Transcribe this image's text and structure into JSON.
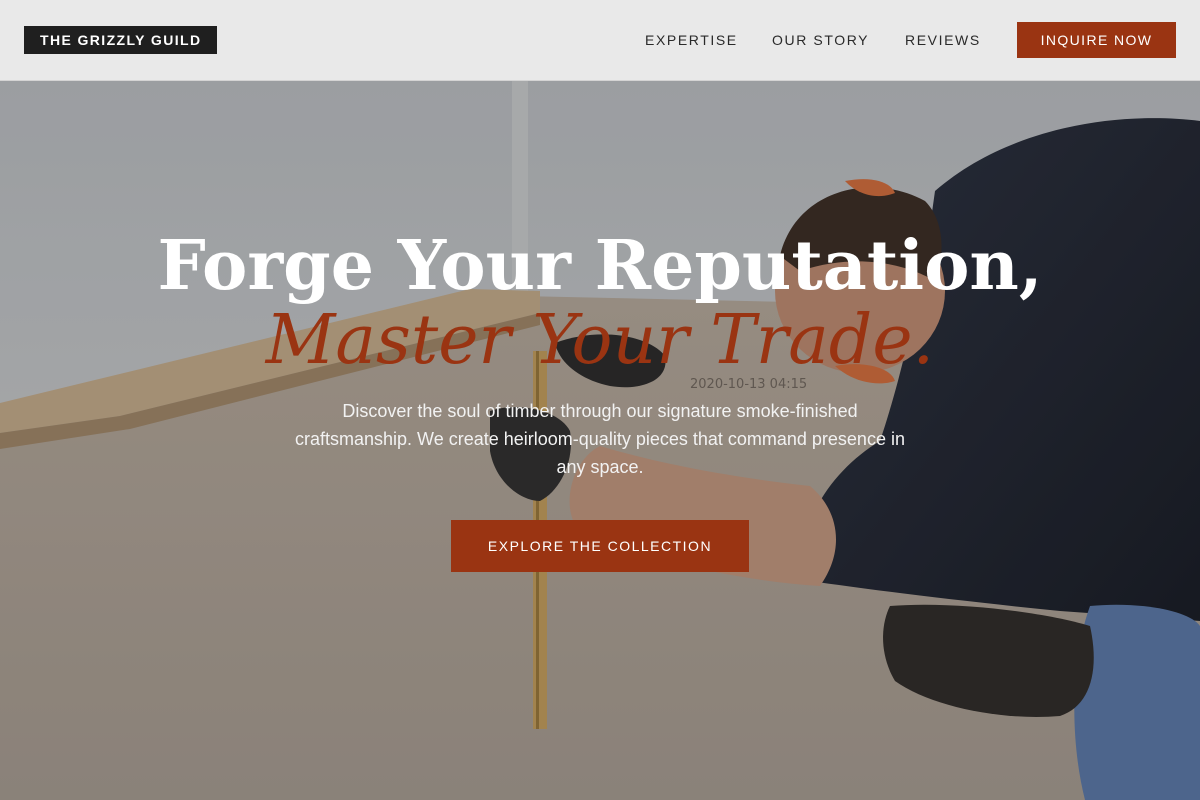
{
  "header": {
    "logo": "THE GRIZZLY GUILD",
    "nav": {
      "expertise": "EXPERTISE",
      "story": "OUR STORY",
      "reviews": "REVIEWS"
    },
    "cta": "INQUIRE NOW"
  },
  "hero": {
    "headline": "Forge Your Reputation,",
    "headline_accent": "Master Your Trade.",
    "subtitle": "Discover the soul of timber through our signature smoke-finished craftsmanship. We create heirloom-quality pieces that command presence in any space.",
    "button": "EXPLORE THE COLLECTION",
    "photo_overlay_text": "2020-10-13 04:15"
  },
  "colors": {
    "accent": "#9a3412",
    "header_bg": "#e9e9e9",
    "logo_bg": "#1f1f1f"
  }
}
